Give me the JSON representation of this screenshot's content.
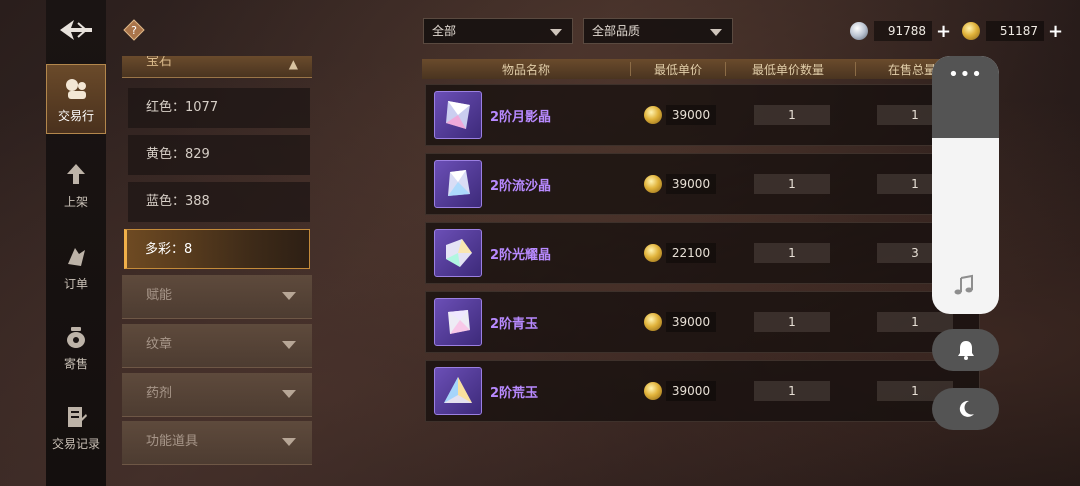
{
  "nav": {
    "items": [
      {
        "label": "交易行",
        "icon": "auction-house-icon"
      },
      {
        "label": "上架",
        "icon": "list-item-icon"
      },
      {
        "label": "订单",
        "icon": "order-icon"
      },
      {
        "label": "寄售",
        "icon": "consign-bag-icon"
      },
      {
        "label": "交易记录",
        "icon": "trade-record-icon"
      }
    ]
  },
  "categories": {
    "expanded_label": "宝石",
    "sub_items": [
      {
        "label": "红色：1077"
      },
      {
        "label": "黄色：829"
      },
      {
        "label": "蓝色：388"
      },
      {
        "label": "多彩：8"
      }
    ],
    "folded": [
      {
        "label": "赋能"
      },
      {
        "label": "纹章"
      },
      {
        "label": "药剂"
      },
      {
        "label": "功能道具"
      }
    ]
  },
  "filters": {
    "type": "全部",
    "quality": "全部品质"
  },
  "currency": {
    "silver": "91788",
    "gold": "51187"
  },
  "table": {
    "headers": [
      "物品名称",
      "最低单价",
      "最低单价数量",
      "在售总量"
    ],
    "rows": [
      {
        "name": "2阶月影晶",
        "price": "39000",
        "qty": "1",
        "total": "1"
      },
      {
        "name": "2阶流沙晶",
        "price": "39000",
        "qty": "1",
        "total": "1"
      },
      {
        "name": "2阶光耀晶",
        "price": "22100",
        "qty": "1",
        "total": "3"
      },
      {
        "name": "2阶青玉",
        "price": "39000",
        "qty": "1",
        "total": "1"
      },
      {
        "name": "2阶荒玉",
        "price": "39000",
        "qty": "1",
        "total": "1"
      }
    ]
  },
  "colors": {
    "accent_gold": "#c48b3a",
    "item_name_purple": "#b88aff"
  }
}
